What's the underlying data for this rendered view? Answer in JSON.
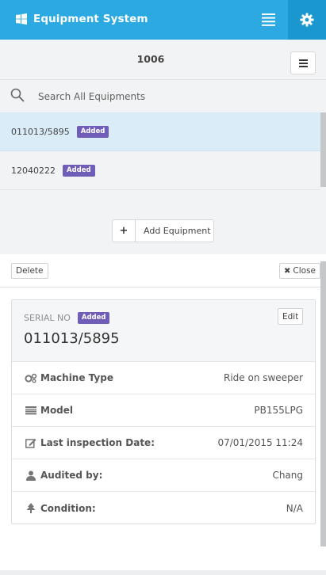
{
  "header": {
    "title": "Equipment System",
    "brand_color": "#2ba9e0"
  },
  "panel": {
    "group_number": "1006",
    "search_placeholder": "Search All Equipments",
    "items": [
      {
        "serial": "011013/5895",
        "badge": "Added",
        "selected": true
      },
      {
        "serial": "12040222",
        "badge": "Added",
        "selected": false
      }
    ],
    "add_button_label": "Add Equipment"
  },
  "actions": {
    "delete_label": "Delete",
    "close_label": "Close"
  },
  "detail": {
    "serial_label": "SERIAL NO",
    "badge": "Added",
    "serial_value": "011013/5895",
    "edit_label": "Edit",
    "fields": [
      {
        "icon": "gears-icon",
        "label": "Machine Type",
        "value": "Ride on sweeper"
      },
      {
        "icon": "model-icon",
        "label": "Model",
        "value": "PB155LPG"
      },
      {
        "icon": "edit-calendar-icon",
        "label": "Last inspection Date:",
        "value": "07/01/2015 11:24"
      },
      {
        "icon": "user-icon",
        "label": "Audited by:",
        "value": "Chang"
      },
      {
        "icon": "tree-icon",
        "label": "Condition:",
        "value": "N/A"
      }
    ]
  },
  "colors": {
    "accent": "#2ba9e0",
    "badge": "#6f5db8",
    "selected_row": "#d9ecf8"
  }
}
